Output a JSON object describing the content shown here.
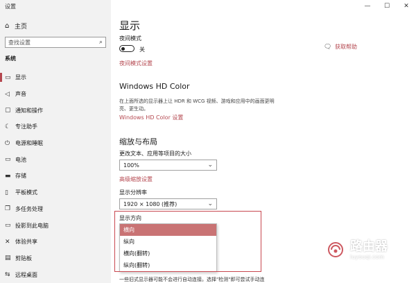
{
  "window": {
    "title": "设置",
    "controls": [
      "—",
      "☐",
      "✕"
    ]
  },
  "sidebar": {
    "home": {
      "icon": "home-icon",
      "glyph": "⌂",
      "label": "主页"
    },
    "search": {
      "placeholder": "查找设置",
      "icon": "search-icon"
    },
    "section": "系统",
    "items": [
      {
        "label": "显示",
        "icon": "monitor-icon",
        "glyph": "▭"
      },
      {
        "label": "声音",
        "icon": "speaker-icon",
        "glyph": "◁"
      },
      {
        "label": "通知和操作",
        "icon": "notification-icon",
        "glyph": "▢"
      },
      {
        "label": "专注助手",
        "icon": "moon-icon",
        "glyph": "☾"
      },
      {
        "label": "电源和睡眠",
        "icon": "power-icon",
        "glyph": "⏻"
      },
      {
        "label": "电池",
        "icon": "battery-icon",
        "glyph": "▭"
      },
      {
        "label": "存储",
        "icon": "storage-icon",
        "glyph": "▬"
      },
      {
        "label": "平板模式",
        "icon": "tablet-icon",
        "glyph": "▯"
      },
      {
        "label": "多任务处理",
        "icon": "multitask-icon",
        "glyph": "❐"
      },
      {
        "label": "投影到此电脑",
        "icon": "project-icon",
        "glyph": "▭"
      },
      {
        "label": "体验共享",
        "icon": "share-icon",
        "glyph": "✕"
      },
      {
        "label": "剪贴板",
        "icon": "clipboard-icon",
        "glyph": "▤"
      },
      {
        "label": "远程桌面",
        "icon": "remote-icon",
        "glyph": "⇆"
      }
    ]
  },
  "main": {
    "title": "显示",
    "night_light": {
      "label": "夜间模式",
      "state": "关",
      "settings_link": "夜间模式设置"
    },
    "help": {
      "icon": "help-icon",
      "label": "获取帮助"
    },
    "hdr": {
      "title": "Windows HD Color",
      "description": "在上面所选的显示器上让 HDR 和 WCG 视频、游戏和应用中的画面更明亮、更生动。",
      "link": "Windows HD Color 设置"
    },
    "scale": {
      "title": "缩放与布局",
      "label": "更改文本、应用等项目的大小",
      "value": "100%",
      "advanced_link": "高级缩放设置"
    },
    "resolution": {
      "label": "显示分辨率",
      "value": "1920 × 1080 (推荐)"
    },
    "orientation": {
      "label": "显示方向",
      "options": [
        "横向",
        "纵向",
        "横向(翻转)",
        "纵向(翻转)"
      ],
      "selected_index": 0
    },
    "bottom_note": "一些旧式显示器可能不会进行自动连接。选择\"检测\"即可尝试手动连"
  },
  "watermark": {
    "text": "路由器",
    "url": "luyouqi.com"
  },
  "colors": {
    "accent": "#b4474f",
    "selected_bg": "#c97374",
    "sidebar_bg": "#f2f2f2",
    "highlight_border": "#c8474f"
  }
}
